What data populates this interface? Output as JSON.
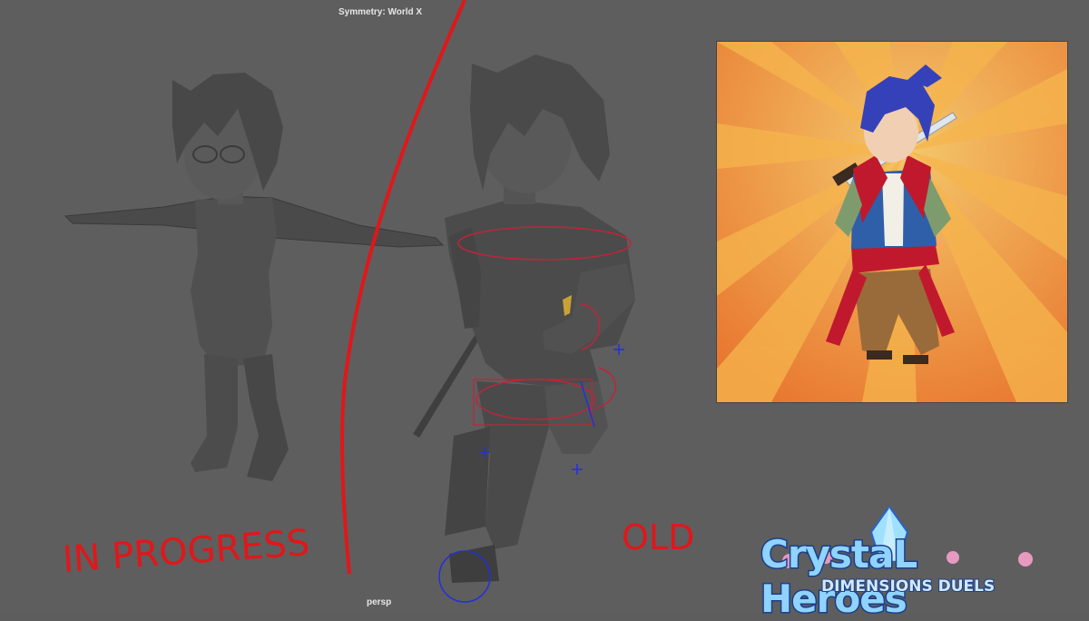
{
  "viewport": {
    "symmetry_label": "Symmetry: World X",
    "camera_label": "persp"
  },
  "annotations": {
    "left_label": "IN PROGRESS",
    "right_label": "OLD"
  },
  "logo": {
    "line1": "CrystaL Heroes",
    "line2": "DIMENSIONS DUELS"
  },
  "colors": {
    "viewport_bg": "#5e5e5e",
    "annotation_red": "#e0171a",
    "control_blue": "#2330d8",
    "concept_orange": "#e8772f"
  }
}
